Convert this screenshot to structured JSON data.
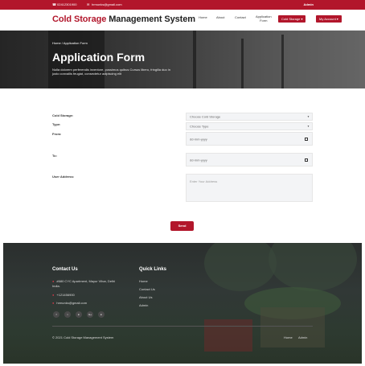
{
  "topbar": {
    "phone": "02412301900",
    "email": "hrmunks@gmail.com",
    "admin": "Admin"
  },
  "navbar": {
    "brand_part1": "Cold Storage",
    "brand_part2": "Management System",
    "links": {
      "home": "Home",
      "about": "About",
      "contact": "Contact",
      "application_1": "Application",
      "application_2": "Form"
    },
    "cold_storage_btn": "Cold Storage ▾",
    "my_account_btn": "My Account ▾"
  },
  "hero": {
    "breadcrumb": "Home  /  Application Form",
    "title": "Application Form",
    "text": "Nulla dolorem perferendis inventore, possimus quibus Cursus libero, fringilla duo in justo convallis feugiat, consectetur adipiscing elit"
  },
  "form": {
    "cold_storage_label": "Cold Storage:",
    "cold_storage_value": "Choose Cold Storage",
    "type_label": "Type:",
    "type_value": "Choose Type",
    "from_label": "From:",
    "from_value": "dd-mm-yyyy",
    "to_label": "To:",
    "to_value": "dd-mm-yyyy",
    "address_label": "User Address:",
    "address_placeholder": "Enter Your Address",
    "send": "Send"
  },
  "footer": {
    "contact_heading": "Contact Us",
    "address_line1": "#680 CYC Apartment, Mayur Vihar, Delhi",
    "address_line2": "India.",
    "phone": "+121456900",
    "email": "hrmunks@gmail.com",
    "quick_heading": "Quick Links",
    "quick_links": [
      "Home",
      "Contact Us",
      "About Us",
      "Admin"
    ],
    "social": [
      "f",
      "t",
      "in",
      "G+",
      "in"
    ],
    "copyright": "© 2021 Cold Storage Management System",
    "bottom_links": [
      "Home",
      "Admin"
    ]
  },
  "colors": {
    "brand_red": "#b2162b",
    "footer_bg": "#2f3533"
  }
}
